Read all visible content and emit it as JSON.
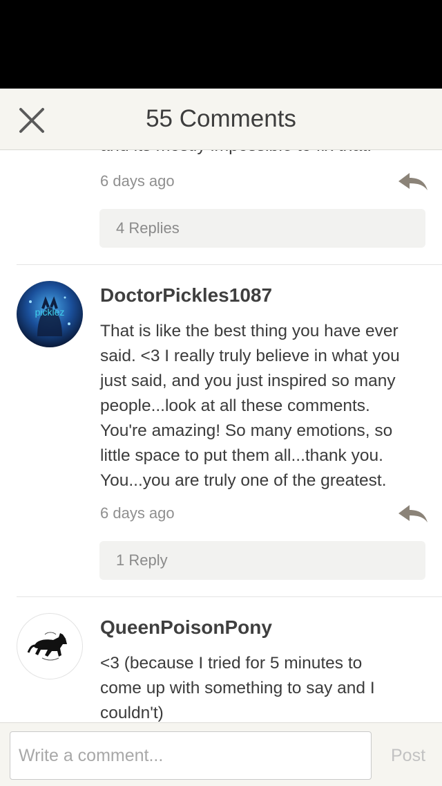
{
  "header": {
    "title": "55 Comments",
    "close_icon": "close-icon"
  },
  "previous_comment": {
    "partial_text": "and its mostly impossible to fix that.",
    "timestamp": "6 days ago",
    "replies_label": "4 Replies"
  },
  "comments": [
    {
      "username": "DoctorPickles1087",
      "avatar_text": "picklez",
      "lines": [
        "That is like the best thing you have ever",
        "said. <3 I really truly believe in what you",
        "just said, and you just inspired so many",
        "people...look at all these comments.",
        "You're amazing! So many emotions, so",
        "little space to put them all...thank you.",
        "You...you are truly one of the greatest."
      ],
      "timestamp": "6 days ago",
      "replies_label": "1 Reply"
    },
    {
      "username": "QueenPoisonPony",
      "lines": [
        "<3 (because I tried for 5 minutes to",
        "come up with something to say and I",
        "couldn't)"
      ]
    }
  ],
  "composer": {
    "placeholder": "Write a comment...",
    "post_label": "Post"
  },
  "colors": {
    "header_bg": "#f6f5f0",
    "accent_icon": "#8b8378",
    "text": "#3b3b3b",
    "muted": "#8f8f8f"
  }
}
